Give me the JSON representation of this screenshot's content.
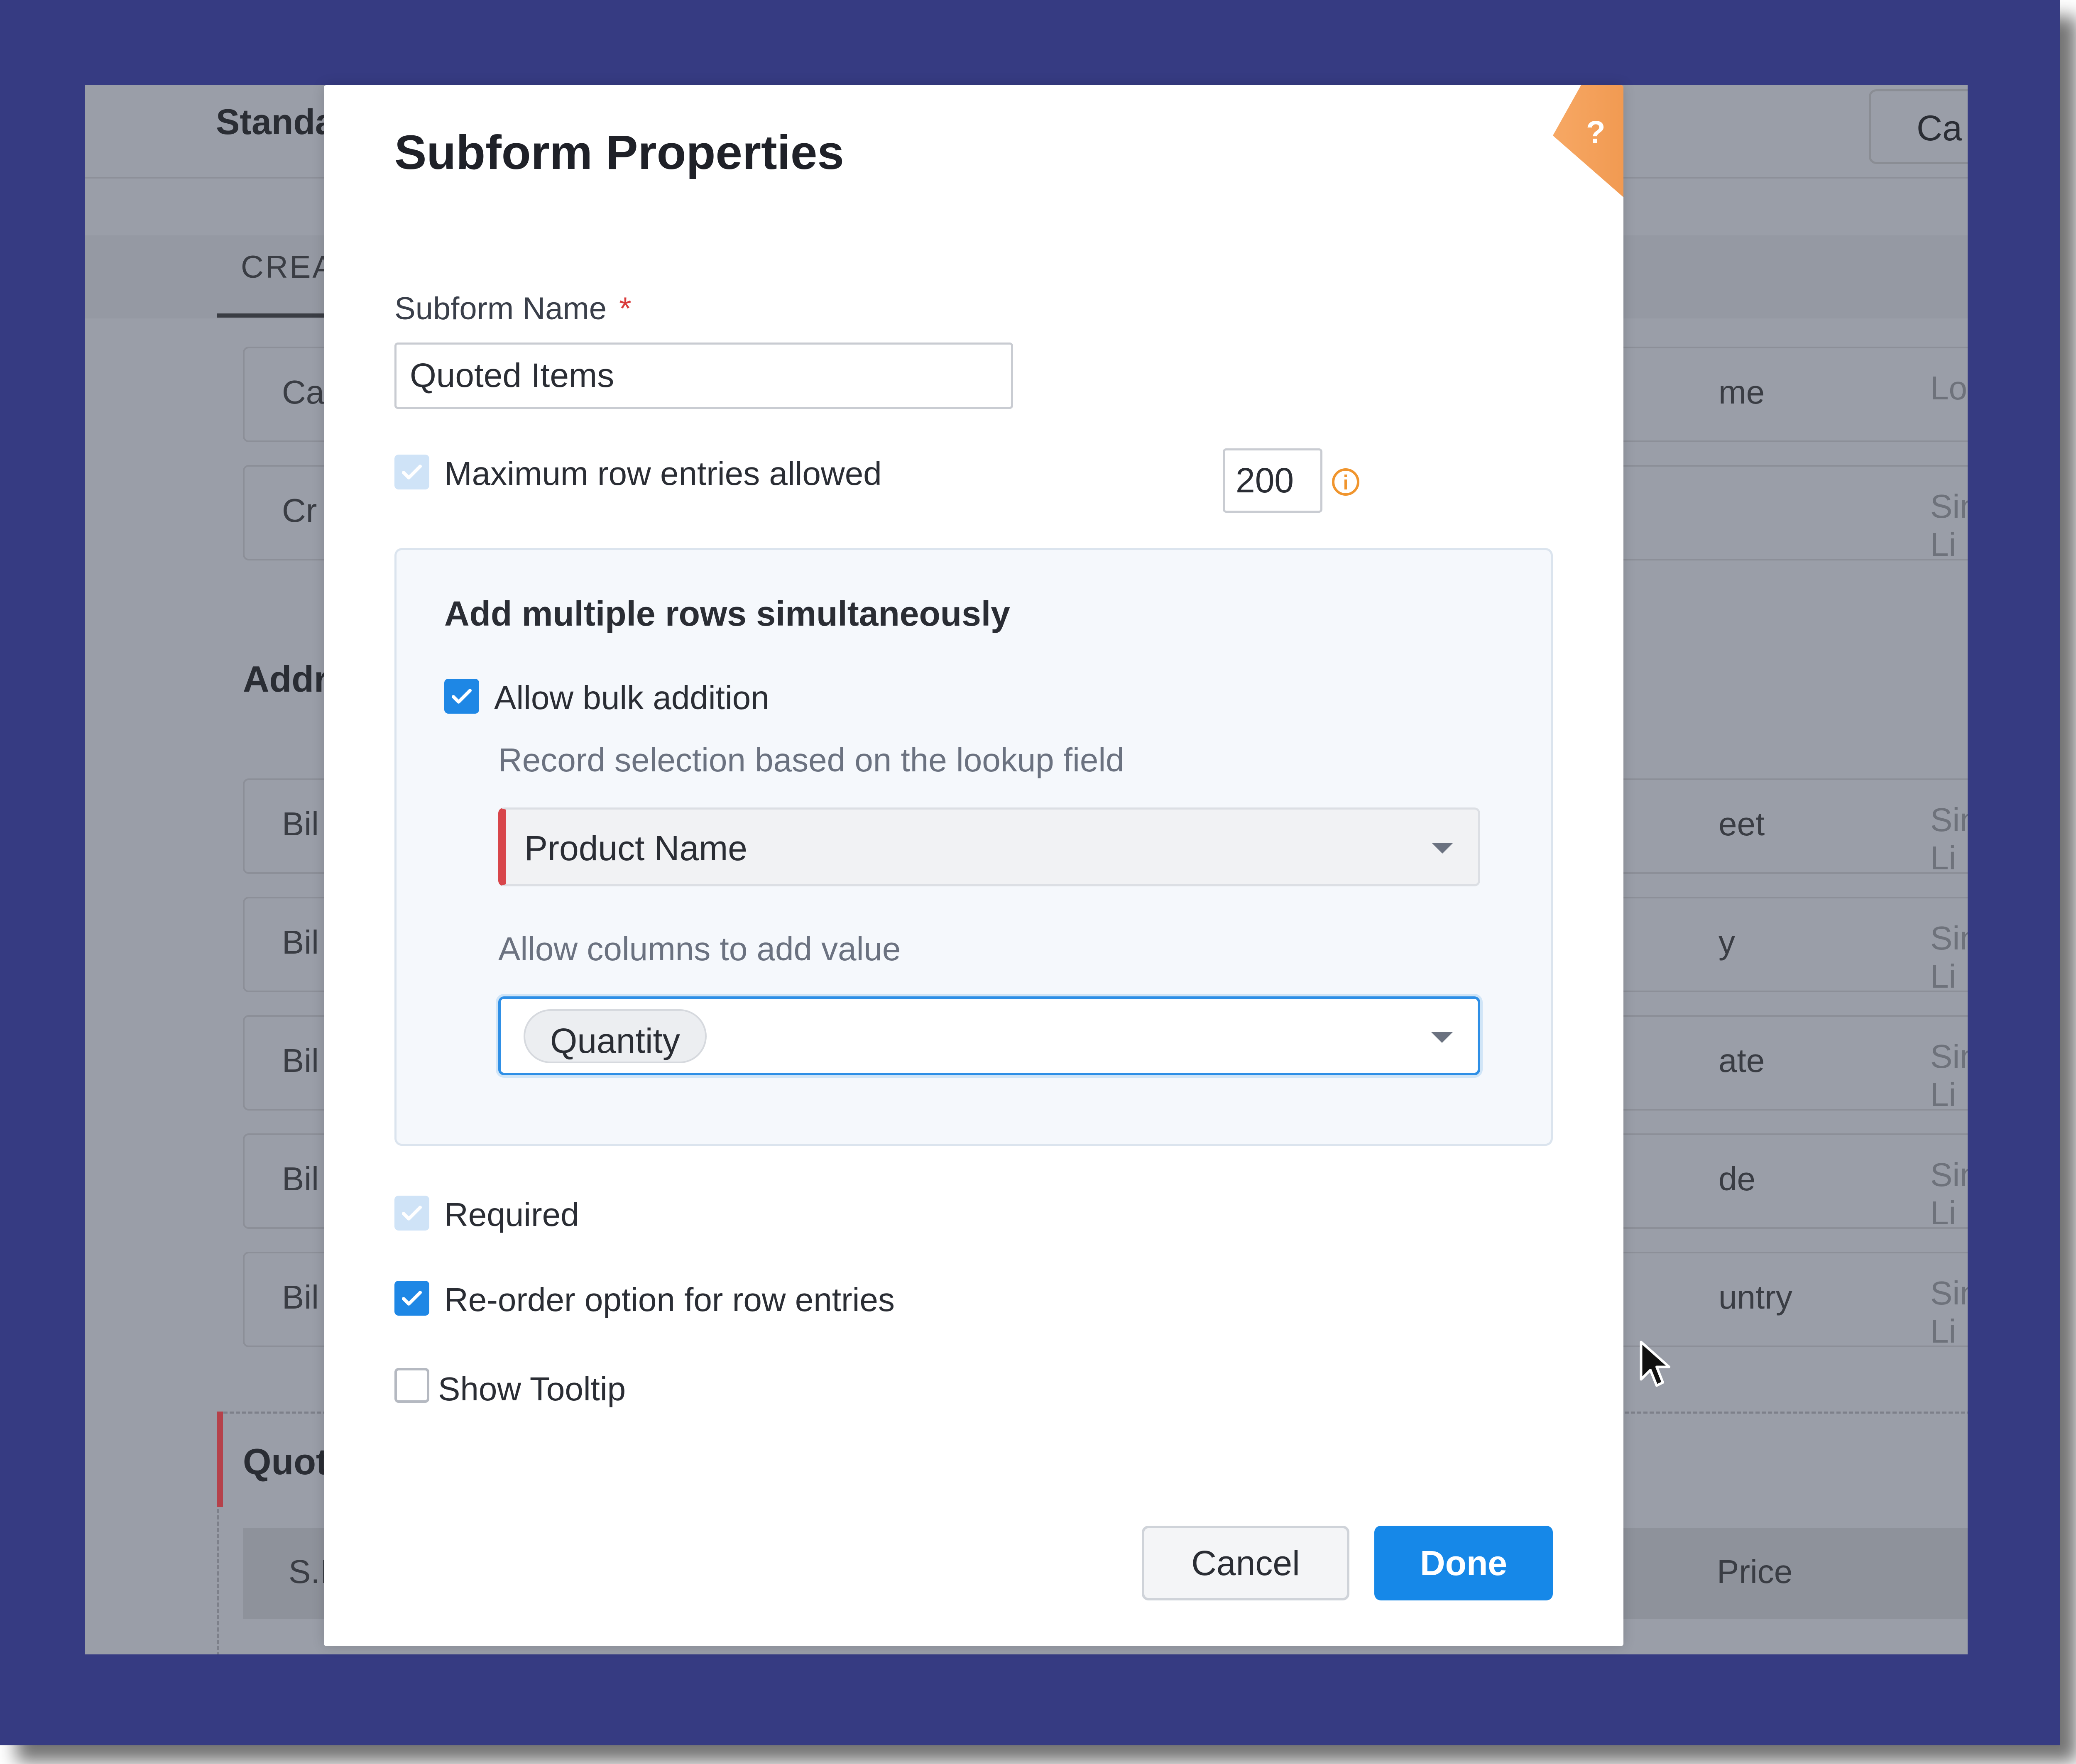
{
  "background": {
    "title_partial": "Standa",
    "button_partial": "Ca",
    "tab_partial": "CREA",
    "address_section_partial": "Addr",
    "quoted_section_partial": "Quot",
    "top_rows": [
      {
        "left": "Ca",
        "right": "me",
        "type": "Lookup"
      },
      {
        "left": "Cr",
        "right": "",
        "type": "Single Li"
      }
    ],
    "address_rows": [
      {
        "left": "Bil",
        "right": "eet",
        "type": "Single Li"
      },
      {
        "left": "Bil",
        "right": "y",
        "type": "Single Li"
      },
      {
        "left": "Bil",
        "right": "ate",
        "type": "Single Li"
      },
      {
        "left": "Bil",
        "right": "de",
        "type": "Single Li"
      },
      {
        "left": "Bil",
        "right": "untry",
        "type": "Single Li"
      }
    ],
    "table_header": {
      "left": "S.I",
      "right": "Price",
      "more": "..."
    }
  },
  "modal": {
    "title": "Subform Properties",
    "help_label": "?",
    "subform_name": {
      "label": "Subform Name",
      "required_mark": "*",
      "value": "Quoted Items"
    },
    "max_rows": {
      "label": "Maximum row entries allowed",
      "value": "200",
      "checked": true,
      "disabled": true
    },
    "bulk": {
      "title": "Add multiple rows simultaneously",
      "allow_label": "Allow bulk addition",
      "lookup_label": "Record selection based on the lookup field",
      "lookup_value": "Product Name",
      "columns_label": "Allow columns to add value",
      "columns_chips": [
        "Quantity"
      ]
    },
    "options": {
      "required_label": "Required",
      "reorder_label": "Re-order option for row entries",
      "tooltip_label": "Show Tooltip"
    },
    "buttons": {
      "cancel": "Cancel",
      "done": "Done"
    }
  },
  "colors": {
    "frame": "#363b82",
    "primary": "#1688e8",
    "help_badge": "#f19a52",
    "required_mark": "#d93b3b",
    "lookup_accent": "#d8464b"
  }
}
